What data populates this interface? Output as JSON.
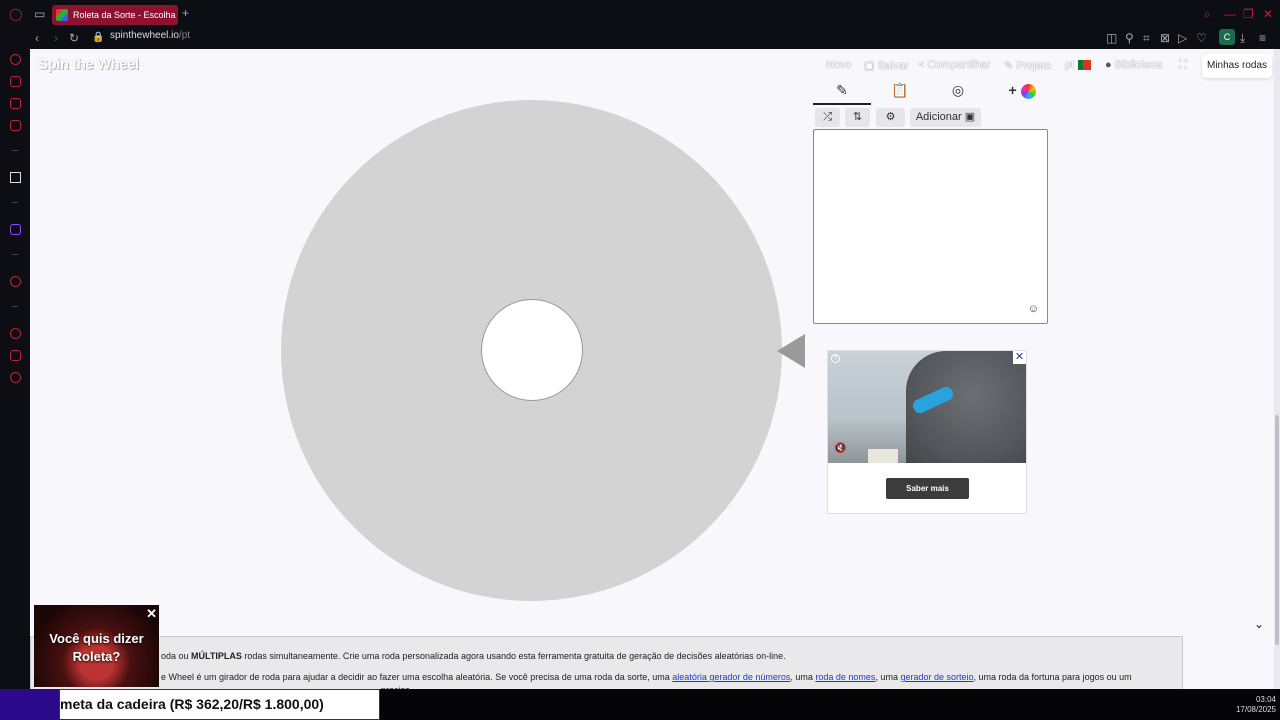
{
  "browser": {
    "tab_title": "Roleta da Sorte - Escolha",
    "tab_new": "+",
    "url_host": "spinthewheel.io",
    "url_path": "/pt",
    "profile_initial": "C"
  },
  "header": {
    "logo": "Spin the Wheel",
    "nav": {
      "new": "Novo",
      "save": "Salvar",
      "share": "Compartilhar",
      "project": "Projeto",
      "language": "pt",
      "library": "Biblioteca",
      "my_wheels": "Minhas rodas"
    }
  },
  "editor": {
    "tabs": [
      "edit-icon",
      "clipboard-icon",
      "eye-slash-icon"
    ],
    "add_color": "+",
    "tools": {
      "shuffle": "⤮",
      "sort": "⇅",
      "settings": "⚙",
      "add_image": "Adicionar"
    },
    "entries_text": ""
  },
  "ad": {
    "info": "?",
    "close": "✕",
    "cta": "Saber mais"
  },
  "info_text": {
    "line1_a": "oda ou ",
    "line1_bold": "MÚLTIPLAS",
    "line1_b": " rodas simultaneamente. Crie uma roda personalizada agora usando esta ferramenta gratuita de geração de decisões aleatórias on-line.",
    "line2_a": "e Wheel é um girador de roda para ajudar a decidir ao fazer uma escolha aleatória. Se você precisa de uma roda da sorte, uma ",
    "link1": "aleatória gerador de números",
    "line2_b": ", uma ",
    "link2": "roda de nomes",
    "line2_c": ", uma ",
    "link3": "gerador de sorteio",
    "line2_d": ", uma roda da fortuna para jogos ou um",
    "line3": "precisa"
  },
  "promo": {
    "text_line1": "Você quis dizer",
    "text_line2": "Roleta?",
    "close": "✕"
  },
  "ticker": {
    "text": "meta da cadeira (R$ 362,20/R$ 1.800,00)"
  },
  "clock": {
    "time": "03:04",
    "date": "17/08/2025"
  }
}
